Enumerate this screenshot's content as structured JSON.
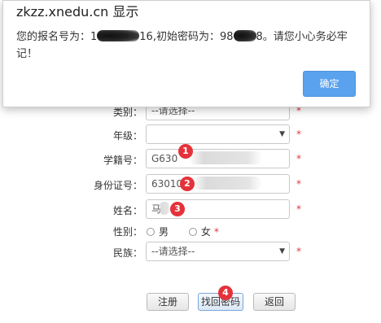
{
  "dialog": {
    "title": "zkzz.xnedu.cn 显示",
    "message_line1_prefix": "您的报名号为：1",
    "message_line1_mid": "16,初始密码为：98",
    "message_line1_suffix": "8。请您小心务必牢",
    "message_line2": "记！",
    "ok_label": "确定"
  },
  "form": {
    "category": {
      "label": "类别：",
      "value": "--请选择--"
    },
    "grade": {
      "label": "年级：",
      "value": ""
    },
    "student_id": {
      "label": "学籍号：",
      "value": "G630"
    },
    "id_number": {
      "label": "身份证号：",
      "value": "63010"
    },
    "name": {
      "label": "姓名：",
      "value": "马"
    },
    "gender": {
      "label": "性别：",
      "male": "男",
      "female": "女"
    },
    "ethnicity": {
      "label": "民族：",
      "value": "--请选择--"
    },
    "required_mark": "*",
    "select_arrow": "▼"
  },
  "buttons": {
    "register": "注册",
    "find_password": "找回密码",
    "back": "返回"
  },
  "badges": [
    "1",
    "2",
    "3",
    "4"
  ]
}
